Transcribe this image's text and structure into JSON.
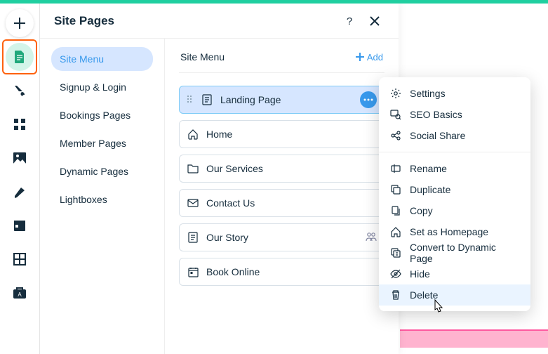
{
  "header": {
    "title": "Site Pages"
  },
  "sidebar": {
    "items": [
      {
        "label": "Site Menu"
      },
      {
        "label": "Signup & Login"
      },
      {
        "label": "Bookings Pages"
      },
      {
        "label": "Member Pages"
      },
      {
        "label": "Dynamic Pages"
      },
      {
        "label": "Lightboxes"
      }
    ]
  },
  "main": {
    "section_title": "Site Menu",
    "add_label": "Add",
    "pages": [
      {
        "label": "Landing Page"
      },
      {
        "label": "Home"
      },
      {
        "label": "Our Services"
      },
      {
        "label": "Contact Us"
      },
      {
        "label": "Our Story"
      },
      {
        "label": "Book Online"
      }
    ]
  },
  "context_menu": {
    "items": [
      {
        "label": "Settings"
      },
      {
        "label": "SEO Basics"
      },
      {
        "label": "Social Share"
      },
      {
        "label": "Rename"
      },
      {
        "label": "Duplicate"
      },
      {
        "label": "Copy"
      },
      {
        "label": "Set as Homepage"
      },
      {
        "label": "Convert to Dynamic Page"
      },
      {
        "label": "Hide"
      },
      {
        "label": "Delete"
      }
    ]
  }
}
